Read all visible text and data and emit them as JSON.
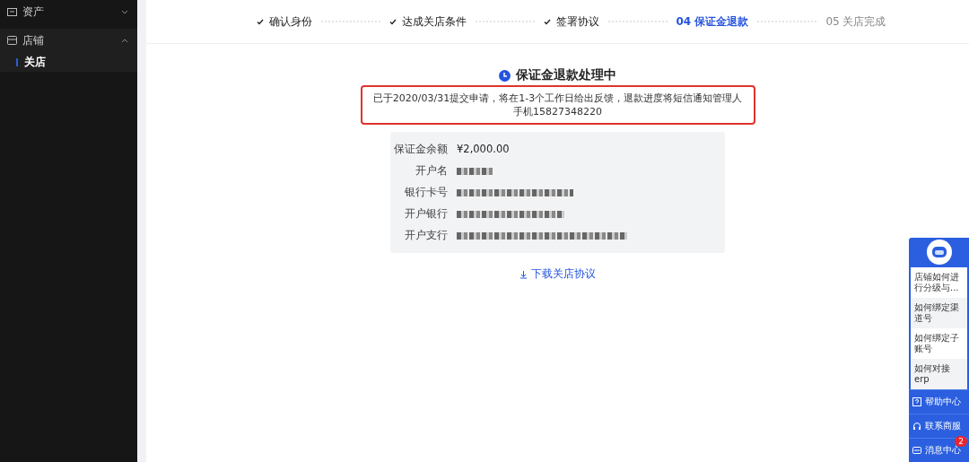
{
  "sidebar": {
    "items": [
      {
        "label": "资产",
        "expanded": false
      },
      {
        "label": "店铺",
        "expanded": true,
        "children": [
          {
            "label": "关店",
            "selected": true
          }
        ]
      }
    ]
  },
  "steps": [
    {
      "label": "确认身份",
      "completed": true,
      "selected": false
    },
    {
      "label": "达成关店条件",
      "completed": true,
      "selected": false
    },
    {
      "label": "签署协议",
      "completed": true,
      "selected": false
    },
    {
      "label": "04 保证金退款",
      "completed": false,
      "selected": true
    },
    {
      "label": "05 关店完成",
      "completed": false,
      "selected": false
    }
  ],
  "status": {
    "title": "保证金退款处理中",
    "message": "已于2020/03/31提交申请，将在1-3个工作日给出反馈，退款进度将短信通知管理人手机15827348220",
    "highlighted": true
  },
  "details": [
    {
      "label": "保证金余额",
      "kind": "text",
      "value": "¥2,000.00"
    },
    {
      "label": "开户名",
      "kind": "redacted"
    },
    {
      "label": "银行卡号",
      "kind": "redacted"
    },
    {
      "label": "开户银行",
      "kind": "redacted"
    },
    {
      "label": "开户支行",
      "kind": "redacted"
    }
  ],
  "download_link": "下载关店协议",
  "help_widget": {
    "questions": [
      "店铺如何进行分级与...",
      "如何绑定渠道号",
      "如何绑定子账号",
      "如何对接erp"
    ],
    "actions": [
      {
        "label": "帮助中心",
        "kind": "help"
      },
      {
        "label": "联系商服",
        "kind": "service"
      },
      {
        "label": "消息中心",
        "kind": "message",
        "badge": "2"
      }
    ]
  }
}
